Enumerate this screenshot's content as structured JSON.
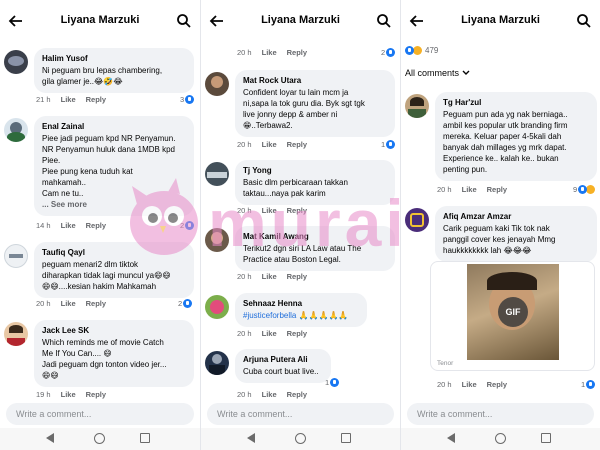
{
  "app": {
    "title": "Liyana Marzuki",
    "write_placeholder": "Write a comment...",
    "colors": {
      "accent": "#1877f2",
      "bubble": "#f0f2f5",
      "muted": "#65676b",
      "hashtag": "#216fdb"
    }
  },
  "actions": {
    "like": "Like",
    "reply": "Reply",
    "see_more": "... See more"
  },
  "col1": {
    "comments": [
      {
        "author": "Halim Yusof",
        "text": "Ni peguam bru lepas chambering,\ngila glamer je..😂🤣😂",
        "time": "21 h",
        "reactions": "3"
      },
      {
        "author": "Enal Zainal",
        "text": "Piee jadi peguam kpd NR Penyamun.\nNR Penyamun huluk dana 1MDB kpd\nPiee.\nPiee pung kena tuduh kat\nmahkamah..\nCam ne tu..",
        "time": "14 h",
        "reactions": "2"
      },
      {
        "author": "Taufiq Qayl",
        "text": "peguam menari2 dlm  tiktok\ndiharapkan tidak lagi muncul ya😄😄\n😄😄....kesian hakim Mahkamah",
        "time": "20 h",
        "reactions": "2"
      },
      {
        "author": "Jack Lee SK",
        "text": "Which reminds me of movie Catch\nMe If You Can.... 😄\nJadi peguam dgn tonton video jer...\n😄😄",
        "time": "19 h",
        "reactions": ""
      }
    ]
  },
  "col2": {
    "top_actions": {
      "time": "20 h",
      "reactions": "2"
    },
    "comments": [
      {
        "author": "Mat Rock Utara",
        "text": "Confident loyar tu lain mcm ja\nni,sapa la tok guru dia. Byk sgt tgk\nlive jonny depp & amber ni\n😁..Terbawa2.",
        "time": "20 h",
        "reactions": "1"
      },
      {
        "author": "Tj Yong",
        "text": "Basic dlm perbicaraan takkan\ntaktau...naya pak karim",
        "time": "20 h",
        "reactions": ""
      },
      {
        "author": "Mat Kamil Awang",
        "text": "Terikut2 dgn siri LA Law atau The\nPractice atau Boston Legal.",
        "time": "20 h",
        "reactions": ""
      },
      {
        "author": "Sehnaaz Henna",
        "text": "#justiceforbella 🙏🙏🙏🙏🙏",
        "time": "20 h",
        "reactions": ""
      },
      {
        "author": "Arjuna Putera Ali",
        "text": "Cuba court buat live..",
        "time": "20 h",
        "reactions": "1"
      }
    ]
  },
  "col3": {
    "top_reactions": "479",
    "filter_label": "All comments",
    "comments": [
      {
        "author": "Tg Har'zul",
        "text": "Peguam pun ada yg nak berniaga..\nambil kes popular utk branding firm\nmereka. Keluar paper 4-5kali dah\nbanyak dah millages yg mrk dapat.\nExperience ke.. kalah ke.. bukan\npenting pun.",
        "time": "20 h",
        "reactions": "9"
      },
      {
        "author": "Afiq Amzar Amzar",
        "text": "Carik peguam kaki Tik tok nak\npanggil cover kes jenayah Mmg\nhaukkkkkkkk lah 😂😂😂",
        "time": "20 h",
        "reactions": "1",
        "gif_label": "GIF",
        "gif_source": "Tenor"
      }
    ]
  },
  "watermark": "murai"
}
